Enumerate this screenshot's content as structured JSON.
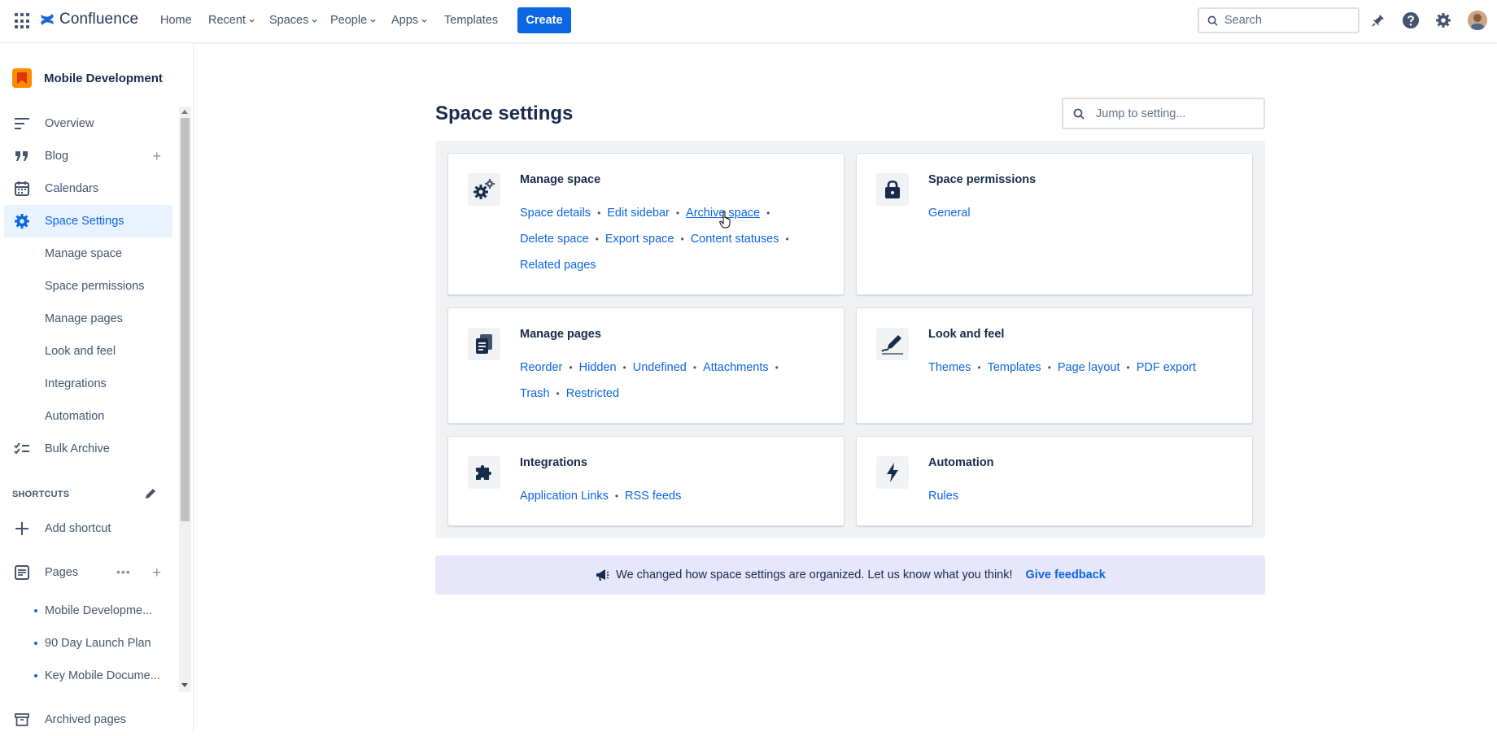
{
  "topnav": {
    "product": "Confluence",
    "items": [
      {
        "label": "Home",
        "dropdown": false
      },
      {
        "label": "Recent",
        "dropdown": true
      },
      {
        "label": "Spaces",
        "dropdown": true
      },
      {
        "label": "People",
        "dropdown": true
      },
      {
        "label": "Apps",
        "dropdown": true
      },
      {
        "label": "Templates",
        "dropdown": false
      }
    ],
    "create_label": "Create",
    "search_placeholder": "Search",
    "icons": [
      "notifications-icon",
      "help-icon",
      "settings-icon",
      "avatar"
    ]
  },
  "sidebar": {
    "space_name": "Mobile Development",
    "items": [
      {
        "label": "Overview",
        "icon": "overview-icon"
      },
      {
        "label": "Blog",
        "icon": "quote-icon"
      },
      {
        "label": "Calendars",
        "icon": "calendar-icon"
      },
      {
        "label": "Space Settings",
        "icon": "gear-icon",
        "active": true
      }
    ],
    "sub_items": [
      "Manage space",
      "Space permissions",
      "Manage pages",
      "Look and feel",
      "Integrations",
      "Automation"
    ],
    "bulk_archive": "Bulk Archive",
    "shortcuts_header": "SHORTCUTS",
    "add_shortcut": "Add shortcut",
    "pages_label": "Pages",
    "pages": [
      "Mobile Developme...",
      "90 Day Launch Plan",
      "Key Mobile Docume..."
    ],
    "archived_pages": "Archived pages"
  },
  "main": {
    "title": "Space settings",
    "jump_placeholder": "Jump to setting...",
    "cards": {
      "manage_space": {
        "title": "Manage space",
        "links": [
          "Space details",
          "Edit sidebar",
          "Archive space",
          "Delete space",
          "Export space",
          "Content statuses",
          "Related pages"
        ]
      },
      "space_permissions": {
        "title": "Space permissions",
        "links": [
          "General"
        ]
      },
      "manage_pages": {
        "title": "Manage pages",
        "links": [
          "Reorder",
          "Hidden",
          "Undefined",
          "Attachments",
          "Trash",
          "Restricted"
        ]
      },
      "look_and_feel": {
        "title": "Look and feel",
        "links": [
          "Themes",
          "Templates",
          "Page layout",
          "PDF export"
        ]
      },
      "integrations": {
        "title": "Integrations",
        "links": [
          "Application Links",
          "RSS feeds"
        ]
      },
      "automation": {
        "title": "Automation",
        "links": [
          "Rules"
        ]
      }
    },
    "feedback": {
      "message": "We changed how space settings are organized. Let us know what you think!",
      "link": "Give feedback"
    }
  },
  "colors": {
    "accent": "#0c66e4",
    "active_bg": "#e9f2ff",
    "feedback_bg": "#e8e6fb"
  }
}
